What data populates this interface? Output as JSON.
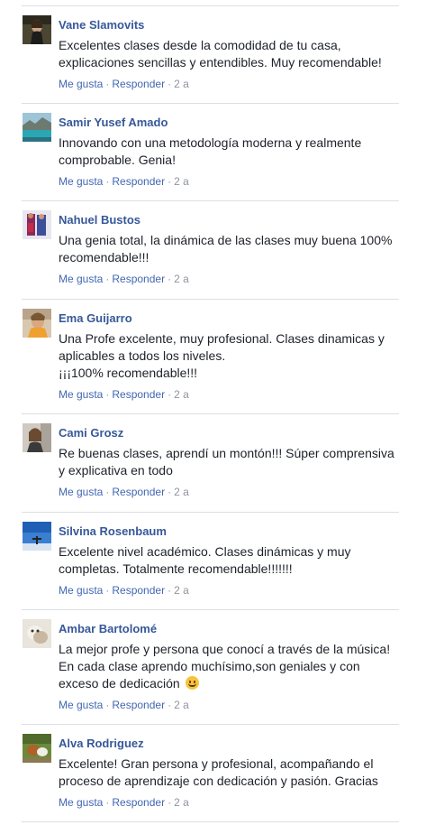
{
  "comments": [
    {
      "author": "Vane Slamovits",
      "text": "Excelentes clases desde la comodidad de tu casa, explicaciones sencillas y entendibles. Muy recomendable!",
      "like": "Me gusta",
      "reply": "Responder",
      "time": "2 a"
    },
    {
      "author": "Samir Yusef Amado",
      "text": "Innovando con una metodología moderna y realmente comprobable. Genia!",
      "like": "Me gusta",
      "reply": "Responder",
      "time": "2 a"
    },
    {
      "author": "Nahuel Bustos",
      "text": "Una genia total, la dinámica de las clases muy buena 100% recomendable!!!",
      "like": "Me gusta",
      "reply": "Responder",
      "time": "2 a"
    },
    {
      "author": "Ema Guijarro",
      "text": "Una Profe excelente, muy profesional. Clases dinamicas y aplicables a todos los niveles.",
      "text2": "¡¡¡100% recomendable!!!",
      "like": "Me gusta",
      "reply": "Responder",
      "time": "2 a"
    },
    {
      "author": "Cami Grosz",
      "text": "Re buenas clases, aprendí un montón!!! Súper comprensiva y explicativa en todo",
      "like": "Me gusta",
      "reply": "Responder",
      "time": "2 a"
    },
    {
      "author": "Silvina Rosenbaum",
      "text": "Excelente nivel académico. Clases dinámicas y muy completas. Totalmente recomendable!!!!!!!",
      "like": "Me gusta",
      "reply": "Responder",
      "time": "2 a"
    },
    {
      "author": "Ambar Bartolomé",
      "text": "La mejor profe y persona que conocí a través de la música! En cada clase aprendo muchísimo,son geniales y con exceso de dedicación",
      "like": "Me gusta",
      "reply": "Responder",
      "time": "2 a"
    },
    {
      "author": "Alva Rodriguez",
      "text": "Excelente! Gran persona y profesional, acompañando el proceso de aprendizaje con dedicación y pasión. Gracias",
      "like": "Me gusta",
      "reply": "Responder",
      "time": "2 a"
    }
  ],
  "separator": "·",
  "emoji": "smiling-face-emoji"
}
